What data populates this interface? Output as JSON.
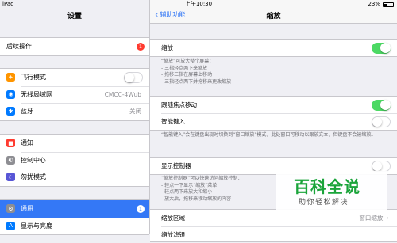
{
  "status_bar": {
    "device": "iPad",
    "time": "上午10:30",
    "battery": "23%"
  },
  "settings_pane": {
    "title": "设置",
    "group1": [
      {
        "label": "后续操作",
        "badge": "1"
      }
    ],
    "group2": [
      {
        "label": "飞行模式",
        "icon": "airplane-icon",
        "color": "#ff9500",
        "glyph": "✈"
      },
      {
        "label": "无线局域网",
        "icon": "wifi-icon",
        "color": "#007aff",
        "glyph": "◉",
        "value": "CMCC-4Wub"
      },
      {
        "label": "蓝牙",
        "icon": "bluetooth-icon",
        "color": "#007aff",
        "glyph": "✱",
        "value": "关闭"
      }
    ],
    "group3": [
      {
        "label": "通知",
        "icon": "notifications-icon",
        "color": "#ff3b30",
        "glyph": "■"
      },
      {
        "label": "控制中心",
        "icon": "control-center-icon",
        "color": "#8e8e93",
        "glyph": "◐"
      },
      {
        "label": "勿扰模式",
        "icon": "do-not-disturb-icon",
        "color": "#5856d6",
        "glyph": "☾"
      }
    ],
    "group4": [
      {
        "label": "通用",
        "icon": "gear-icon",
        "color": "#8e8e93",
        "glyph": "⚙",
        "badge": "1"
      },
      {
        "label": "显示与亮度",
        "icon": "display-brightness-icon",
        "color": "#007aff",
        "glyph": "A"
      }
    ]
  },
  "zoom_pane": {
    "back_label": "辅助功能",
    "title": "缩放",
    "zoom_label": "缩放",
    "zoom_note": [
      "“缩放”可放大整个屏幕：",
      "- 三指轻点两下来缩放",
      "- 拖移三指在屏幕上移动",
      "- 三指轻点两下并拖移来更改缩放"
    ],
    "follow_focus_label": "跟随焦点移动",
    "smart_typing_label": "智能键入",
    "smart_typing_note": "“智能键入”会在键盘出现时切换到“窗口缩放”模式，此处窗口可移动以跟放文本，但键盘不会被缩放。",
    "show_controller_label": "显示控制器",
    "controller_note": [
      "“缩放控制器”可以快速访问缩放控制：",
      "- 轻点一下显示“缩放”菜单",
      "- 轻点两下来放大和缩小",
      "- 放大后，拖移来移动缩放的内容"
    ],
    "zoom_region_label": "缩放区域",
    "zoom_region_value": "窗口缩放",
    "partial_next_label": "缩放滤镜"
  },
  "watermark": {
    "title": "百科全说",
    "subtitle": "助你轻松解决"
  },
  "colors": {
    "accent": "#3478f6",
    "toggle_on": "#4cd964",
    "badge": "#ff3b30"
  }
}
